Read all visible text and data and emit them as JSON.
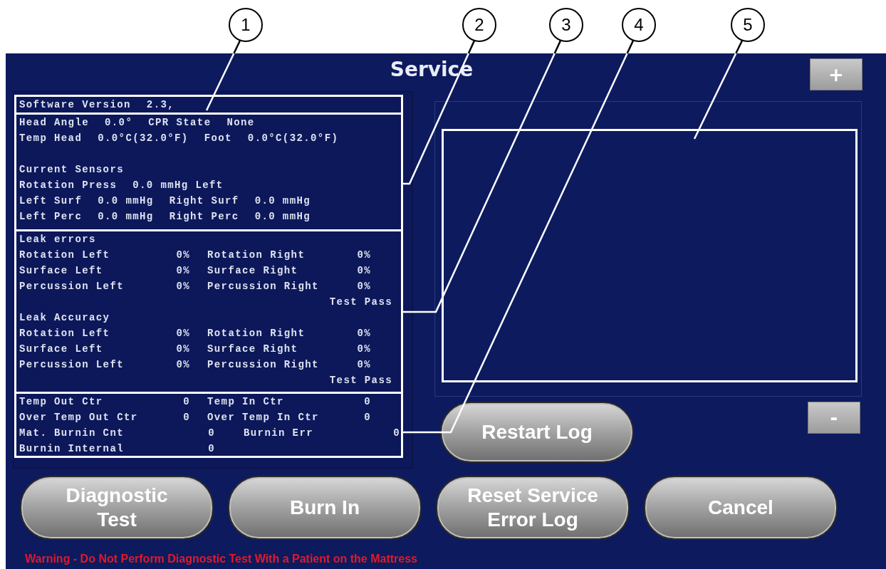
{
  "screen": {
    "title": "Service"
  },
  "callouts": [
    {
      "number": "1"
    },
    {
      "number": "2"
    },
    {
      "number": "3"
    },
    {
      "number": "4"
    },
    {
      "number": "5"
    }
  ],
  "plus_button": {
    "label": "+"
  },
  "info_panel": {
    "sections": [
      {
        "kind": "version",
        "rows": [
          {
            "kind": "line",
            "cells": [
              "Software Version",
              "2.3,"
            ]
          }
        ]
      },
      {
        "kind": "sensors",
        "rows": [
          {
            "kind": "line",
            "cells": [
              "Head Angle",
              "0.0°",
              "CPR State",
              "None"
            ]
          },
          {
            "kind": "line",
            "cells": [
              "Temp Head",
              "0.0°C(32.0°F)",
              "Foot",
              "0.0°C(32.0°F)"
            ]
          },
          {
            "kind": "group_heading",
            "cells": [
              "Current Sensors"
            ]
          },
          {
            "kind": "line",
            "cells": [
              "Rotation Press",
              "0.0 mmHg Left"
            ]
          },
          {
            "kind": "line",
            "cells": [
              "Left Surf",
              "0.0 mmHg",
              "Right Surf",
              "0.0 mmHg"
            ]
          },
          {
            "kind": "line",
            "cells": [
              "Left Perc",
              "0.0 mmHg",
              "Right Perc",
              "0.0 mmHg"
            ]
          }
        ]
      },
      {
        "kind": "leak",
        "rows": [
          {
            "kind": "heading",
            "cells": [
              "Leak errors"
            ]
          },
          {
            "kind": "pair",
            "cells": [
              "Rotation Left",
              "0%",
              "Rotation Right",
              "0%"
            ]
          },
          {
            "kind": "pair",
            "cells": [
              "Surface Left",
              "0%",
              "Surface Right",
              "0%"
            ]
          },
          {
            "kind": "pair",
            "cells": [
              "Percussion Left",
              "0%",
              "Percussion Right",
              "0%"
            ]
          },
          {
            "kind": "result",
            "cells": [
              "Test Pass"
            ]
          },
          {
            "kind": "heading",
            "cells": [
              "Leak Accuracy"
            ]
          },
          {
            "kind": "pair",
            "cells": [
              "Rotation Left",
              "0%",
              "Rotation Right",
              "0%"
            ]
          },
          {
            "kind": "pair",
            "cells": [
              "Surface Left",
              "0%",
              "Surface Right",
              "0%"
            ]
          },
          {
            "kind": "pair",
            "cells": [
              "Percussion Left",
              "0%",
              "Percussion Right",
              "0%"
            ]
          },
          {
            "kind": "result",
            "cells": [
              "Test Pass"
            ]
          }
        ]
      },
      {
        "kind": "counters",
        "rows": [
          {
            "kind": "pair",
            "cells": [
              "Temp Out Ctr",
              "0",
              "Temp In Ctr",
              "0"
            ]
          },
          {
            "kind": "pair",
            "cells": [
              "Over Temp Out Ctr",
              "0",
              "Over Temp In Ctr",
              "0"
            ]
          },
          {
            "kind": "wide_pair",
            "cells": [
              "Mat. Burnin Cnt",
              "0",
              "Burnin Err",
              "0"
            ]
          },
          {
            "kind": "wide_pair",
            "cells": [
              "Burnin Internal",
              "0"
            ]
          }
        ]
      }
    ]
  },
  "restart_button": {
    "label": "Restart Log"
  },
  "minus_button": {
    "label": "-"
  },
  "actions": [
    {
      "label": "Diagnostic Test"
    },
    {
      "label": "Burn In"
    },
    {
      "label": "Reset Service Error Log"
    },
    {
      "label": "Cancel"
    }
  ],
  "warning": "Warning - Do Not Perform Diagnostic Test With a Patient on the Mattress"
}
